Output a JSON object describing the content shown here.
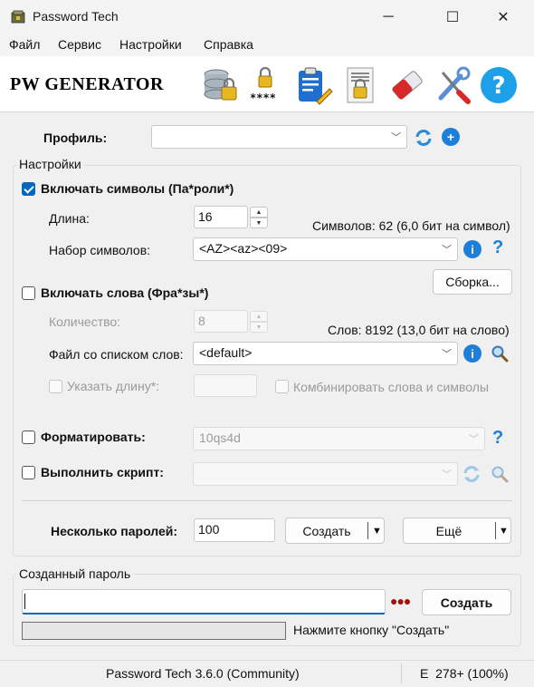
{
  "window": {
    "title": "Password Tech",
    "controls": {
      "minimize": "─",
      "maximize": "☐",
      "close": "✕"
    }
  },
  "menu": [
    "Файл",
    "Сервис",
    "Настройки",
    "Справка"
  ],
  "header": {
    "logo_text": "PW GENERATOR",
    "tools": [
      "database-lock-icon",
      "password-mask-icon",
      "clipboard-edit-icon",
      "document-lock-icon",
      "eraser-icon",
      "tools-icon",
      "help-icon"
    ]
  },
  "profile": {
    "label": "Профиль:",
    "value": ""
  },
  "settings": {
    "group_title": "Настройки",
    "include_chars": {
      "label": "Включать символы (Па*роли*)",
      "checked": true
    },
    "length": {
      "label": "Длина:",
      "value": "16"
    },
    "chars_info": "Символов: 62 (6,0 бит на символ)",
    "charset": {
      "label": "Набор символов:",
      "value": "<AZ><az><09>"
    },
    "build_button": "Сборка...",
    "include_words": {
      "label": "Включать слова (Фра*зы*)",
      "checked": false
    },
    "count": {
      "label": "Количество:",
      "value": "8"
    },
    "words_info": "Слов: 8192 (13,0 бит на слово)",
    "wordlist": {
      "label": "Файл со списком слов:",
      "value": "<default>"
    },
    "specify_length": {
      "label": "Указать длину*:",
      "value": ""
    },
    "combine": {
      "label": "Комбинировать слова и символы"
    },
    "format": {
      "label": "Форматировать:",
      "value": "10qs4d"
    },
    "script": {
      "label": "Выполнить скрипт:",
      "value": ""
    },
    "multi": {
      "label": "Несколько паролей:",
      "value": "100",
      "create_button": "Создать",
      "more_button": "Ещё"
    }
  },
  "generated": {
    "group_title": "Созданный пароль",
    "value": "",
    "dots": "●●●",
    "create_button": "Создать",
    "hint": "Нажмите кнопку \"Создать\""
  },
  "status": {
    "version": "Password Tech 3.6.0 (Community)",
    "zoom": "E  278+ (100%)"
  },
  "colors": {
    "accent": "#0067c0",
    "info_blue": "#1e7fd8",
    "dots_red": "#a01010"
  }
}
